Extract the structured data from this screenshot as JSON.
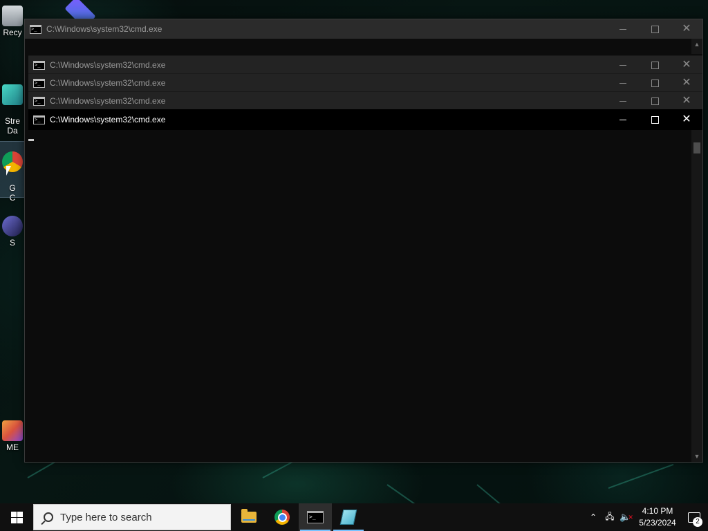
{
  "desktop": {
    "icons": [
      {
        "label": "Recy",
        "color": "#b9c2c9"
      },
      {
        "label": "Stre\nDa",
        "color": "#3fc4b8"
      },
      {
        "label": "G\nC",
        "color": "#d04a3c"
      },
      {
        "label": "S",
        "color": "#3a3a7a"
      },
      {
        "label": "ME",
        "color": "#d9523f"
      }
    ]
  },
  "windows": {
    "main": {
      "title": "C:\\Windows\\system32\\cmd.exe"
    },
    "stacked": [
      {
        "title": "C:\\Windows\\system32\\cmd.exe"
      },
      {
        "title": "C:\\Windows\\system32\\cmd.exe"
      },
      {
        "title": "C:\\Windows\\system32\\cmd.exe"
      }
    ],
    "active": {
      "title": "C:\\Windows\\system32\\cmd.exe"
    },
    "controls": {
      "minimize": "",
      "maximize": "",
      "close": "✕"
    }
  },
  "taskbar": {
    "search_placeholder": "Type here to search",
    "apps": [
      {
        "name": "file-explorer",
        "running": false
      },
      {
        "name": "chrome",
        "running": false
      },
      {
        "name": "command-prompt",
        "running": true,
        "active": true
      },
      {
        "name": "notepad",
        "running": true
      }
    ],
    "tray": {
      "time": "4:10 PM",
      "date": "5/23/2024",
      "notification_count": "2"
    }
  },
  "colors": {
    "terminal_bg": "#0c0c0c",
    "titlebar_active": "#000000",
    "titlebar_inactive": "#2b2b2b",
    "taskbar_bg": "#101010"
  }
}
